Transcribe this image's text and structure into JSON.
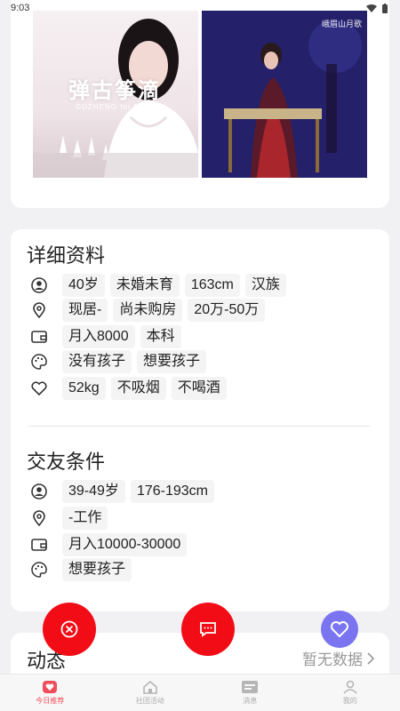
{
  "status_bar": {
    "time": "9:03"
  },
  "photos": {
    "photo1_title": "弹古筝滴",
    "photo1_subtitle": "GUZHENG for ME",
    "photo2_tag": "峨眉山月歌"
  },
  "profile": {
    "title": "详细资料",
    "rows": [
      {
        "icon": "user-circle-icon",
        "chips": [
          "40岁",
          "未婚未育",
          "163cm",
          "汉族"
        ]
      },
      {
        "icon": "location-pin-icon",
        "chips": [
          "现居-",
          "尚未购房",
          "20万-50万"
        ]
      },
      {
        "icon": "wallet-icon",
        "chips": [
          "月入8000",
          "本科"
        ]
      },
      {
        "icon": "palette-icon",
        "chips": [
          "没有孩子",
          "想要孩子"
        ]
      },
      {
        "icon": "heart-outline-icon",
        "chips": [
          "52kg",
          "不吸烟",
          "不喝酒"
        ]
      }
    ]
  },
  "criteria": {
    "title": "交友条件",
    "rows": [
      {
        "icon": "user-circle-icon",
        "chips": [
          "39-49岁",
          "176-193cm"
        ]
      },
      {
        "icon": "location-pin-icon",
        "chips": [
          "-工作"
        ]
      },
      {
        "icon": "wallet-icon",
        "chips": [
          "月入10000-30000"
        ]
      },
      {
        "icon": "palette-icon",
        "chips": [
          "想要孩子"
        ]
      }
    ]
  },
  "dynamics": {
    "title": "动态",
    "empty_label": "暂无数据"
  },
  "tabbar": {
    "tabs": [
      {
        "label": "今日推荐",
        "icon": "heart-badge-icon",
        "active": true
      },
      {
        "label": "社团活动",
        "icon": "home-icon",
        "active": false
      },
      {
        "label": "消息",
        "icon": "message-icon",
        "active": false
      },
      {
        "label": "我的",
        "icon": "person-icon",
        "active": false
      }
    ]
  },
  "colors": {
    "accent_red": "#f20d16",
    "like_purple": "#7b74f0",
    "tab_active": "#f04d5a"
  }
}
